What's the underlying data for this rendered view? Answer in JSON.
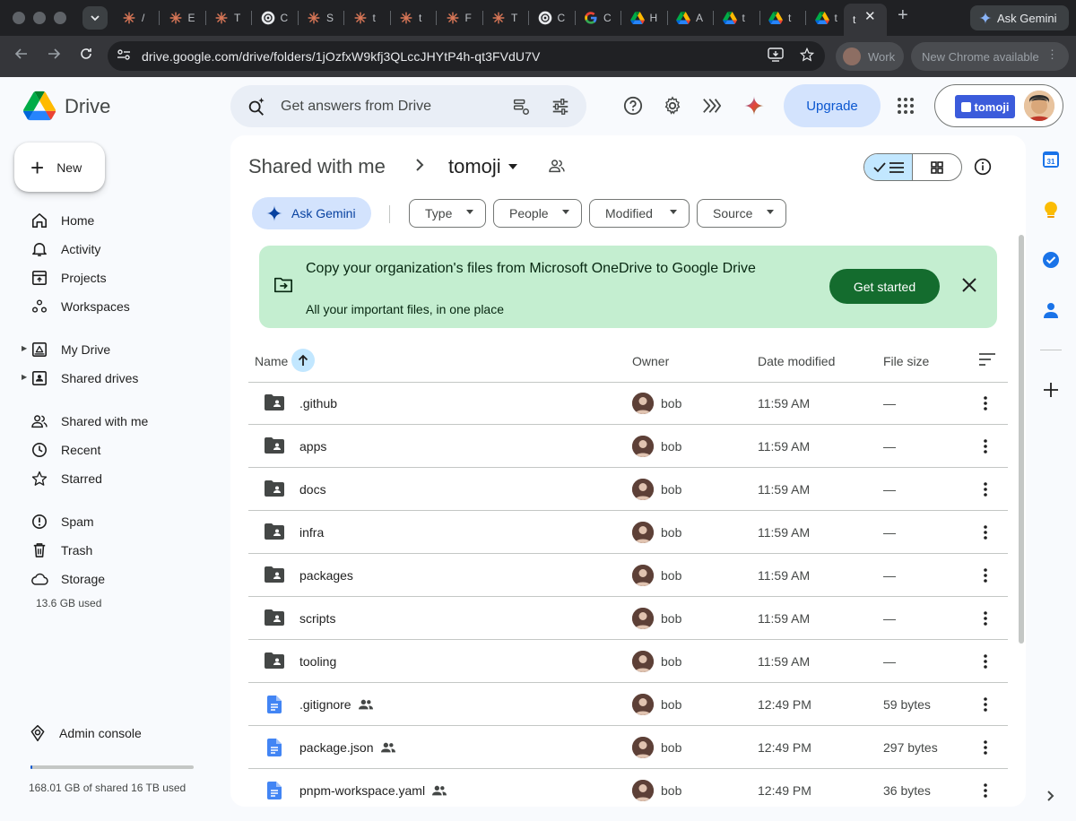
{
  "browser": {
    "tabs": [
      {
        "icon": "claude-icon",
        "letter": "/"
      },
      {
        "icon": "claude-icon",
        "letter": "E"
      },
      {
        "icon": "claude-icon",
        "letter": "T"
      },
      {
        "icon": "chatgpt-icon",
        "letter": "C"
      },
      {
        "icon": "claude-icon",
        "letter": "S"
      },
      {
        "icon": "claude-icon",
        "letter": "t"
      },
      {
        "icon": "claude-icon",
        "letter": "t"
      },
      {
        "icon": "claude-icon",
        "letter": "F"
      },
      {
        "icon": "claude-icon",
        "letter": "T"
      },
      {
        "icon": "chatgpt-icon",
        "letter": "C"
      },
      {
        "icon": "google-icon",
        "letter": "C"
      },
      {
        "icon": "drive-icon",
        "letter": "H"
      },
      {
        "icon": "drive-icon",
        "letter": "A"
      },
      {
        "icon": "drive-icon",
        "letter": "t"
      },
      {
        "icon": "drive-icon",
        "letter": "t"
      },
      {
        "icon": "drive-icon",
        "letter": "t"
      }
    ],
    "active_tab_letter": "t",
    "ask_gemini_label": "Ask Gemini",
    "url": "drive.google.com/drive/folders/1jOzfxW9kfj3QLccJHYtP4h-qt3FVdU7V",
    "profile_label": "Work",
    "update_label": "New Chrome available"
  },
  "header": {
    "app_name": "Drive",
    "search_placeholder": "Get answers from Drive",
    "upgrade_label": "Upgrade",
    "org_name": "tomoji"
  },
  "sidebar": {
    "new_label": "New",
    "groups": [
      [
        {
          "label": "Home",
          "icon": "home-icon"
        },
        {
          "label": "Activity",
          "icon": "bell-icon"
        },
        {
          "label": "Projects",
          "icon": "projects-icon"
        },
        {
          "label": "Workspaces",
          "icon": "workspaces-icon"
        }
      ],
      [
        {
          "label": "My Drive",
          "icon": "my-drive-icon",
          "expandable": true
        },
        {
          "label": "Shared drives",
          "icon": "shared-drives-icon",
          "expandable": true
        }
      ],
      [
        {
          "label": "Shared with me",
          "icon": "people-icon"
        },
        {
          "label": "Recent",
          "icon": "clock-icon"
        },
        {
          "label": "Starred",
          "icon": "star-icon"
        }
      ],
      [
        {
          "label": "Spam",
          "icon": "spam-icon"
        },
        {
          "label": "Trash",
          "icon": "trash-icon"
        },
        {
          "label": "Storage",
          "icon": "cloud-icon"
        }
      ]
    ],
    "storage_used": "13.6 GB used",
    "admin_label": "Admin console",
    "quota_text": "168.01 GB of shared 16 TB used",
    "quota_fraction": 0.0105
  },
  "main": {
    "breadcrumb_root": "Shared with me",
    "breadcrumb_current": "tomoji",
    "ask_gemini_label": "Ask Gemini",
    "filters": [
      "Type",
      "People",
      "Modified",
      "Source"
    ],
    "banner": {
      "title": "Copy your organization's files from Microsoft OneDrive to Google Drive",
      "subtitle": "All your important files, in one place",
      "cta": "Get started"
    },
    "columns": {
      "name": "Name",
      "owner": "Owner",
      "modified": "Date modified",
      "size": "File size"
    },
    "rows": [
      {
        "name": ".github",
        "type": "folder",
        "owner": "bob",
        "modified": "11:59 AM",
        "size": "—",
        "shared": false
      },
      {
        "name": "apps",
        "type": "folder",
        "owner": "bob",
        "modified": "11:59 AM",
        "size": "—",
        "shared": false
      },
      {
        "name": "docs",
        "type": "folder",
        "owner": "bob",
        "modified": "11:59 AM",
        "size": "—",
        "shared": false
      },
      {
        "name": "infra",
        "type": "folder",
        "owner": "bob",
        "modified": "11:59 AM",
        "size": "—",
        "shared": false
      },
      {
        "name": "packages",
        "type": "folder",
        "owner": "bob",
        "modified": "11:59 AM",
        "size": "—",
        "shared": false
      },
      {
        "name": "scripts",
        "type": "folder",
        "owner": "bob",
        "modified": "11:59 AM",
        "size": "—",
        "shared": false
      },
      {
        "name": "tooling",
        "type": "folder",
        "owner": "bob",
        "modified": "11:59 AM",
        "size": "—",
        "shared": false
      },
      {
        "name": ".gitignore",
        "type": "file",
        "owner": "bob",
        "modified": "12:49 PM",
        "size": "59 bytes",
        "shared": true
      },
      {
        "name": "package.json",
        "type": "file",
        "owner": "bob",
        "modified": "12:49 PM",
        "size": "297 bytes",
        "shared": true
      },
      {
        "name": "pnpm-workspace.yaml",
        "type": "file",
        "owner": "bob",
        "modified": "12:49 PM",
        "size": "36 bytes",
        "shared": true
      }
    ]
  },
  "right_rail": {
    "calendar_day": "31"
  },
  "colors": {
    "accent": "#0b57d0",
    "banner_bg": "#c4eed0",
    "banner_cta": "#146c2e",
    "selected_chip": "#c2e7ff",
    "page_bg": "#f8fafd"
  }
}
